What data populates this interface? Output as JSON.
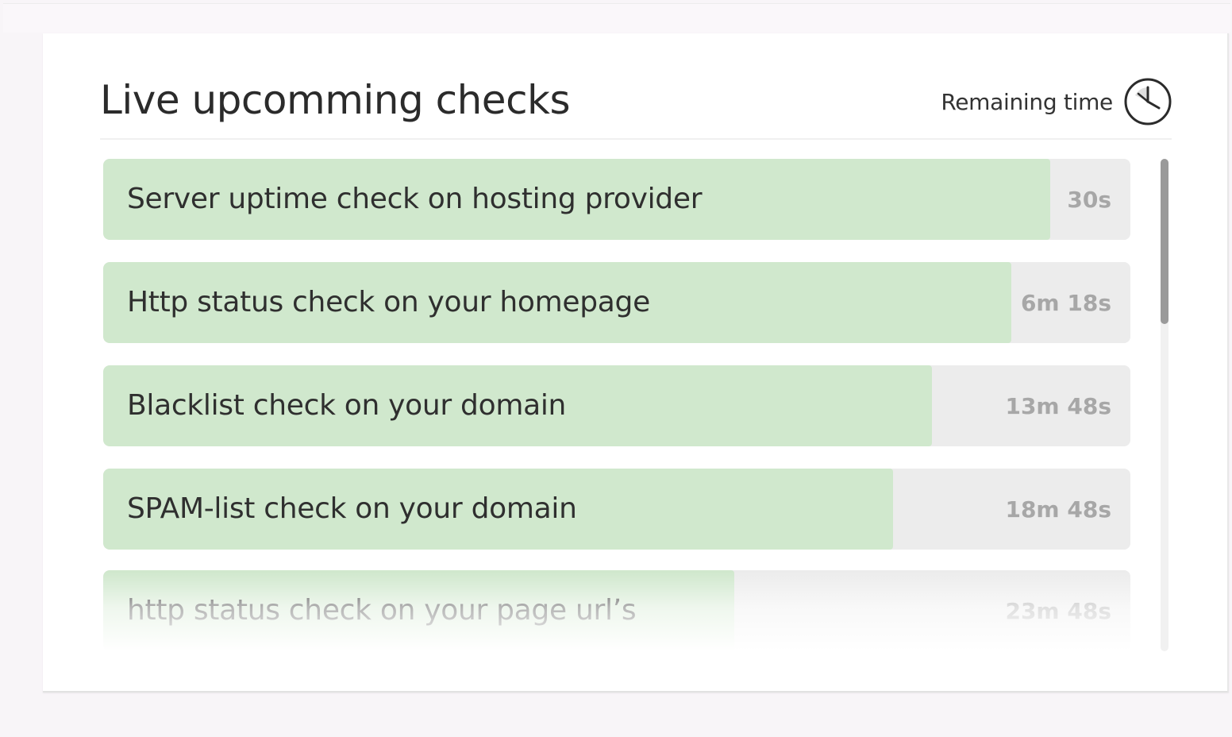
{
  "header": {
    "title": "Live upcomming checks",
    "remaining_label": "Remaining time",
    "clock_icon": "clock-icon"
  },
  "colors": {
    "progress_fill": "#d0e8cd",
    "track": "#ececec",
    "time_text": "#a7a7a7"
  },
  "checks": [
    {
      "label": "Server uptime check on hosting provider",
      "time": "30s",
      "progress": 0.922
    },
    {
      "label": "Http status check on your homepage",
      "time": "6m 18s",
      "progress": 0.884
    },
    {
      "label": "Blacklist check on your domain",
      "time": "13m 48s",
      "progress": 0.807
    },
    {
      "label": "SPAM-list check on your domain",
      "time": "18m 48s",
      "progress": 0.769
    },
    {
      "label": "http status check on your page url’s",
      "time": "23m 48s",
      "progress": 0.614
    }
  ]
}
